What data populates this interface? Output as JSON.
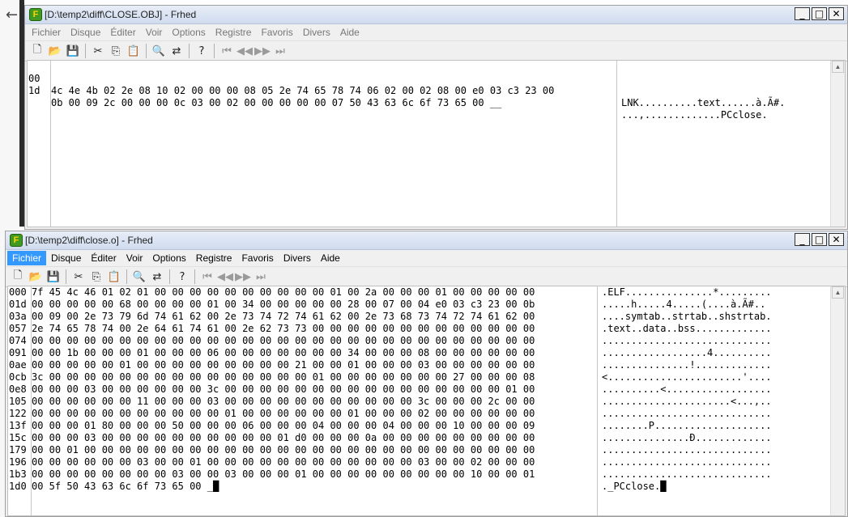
{
  "window1": {
    "title": "[D:\\temp2\\diff\\CLOSE.OBJ] - Frhed",
    "app_icon": "F",
    "menu": [
      "Fichier",
      "Disque",
      "Éditer",
      "Voir",
      "Options",
      "Registre",
      "Favoris",
      "Divers",
      "Aide"
    ],
    "rows": [
      {
        "off": "00",
        "hex": "4c 4e 4b 02 2e 08 10 02 00 00 00 08 05 2e 74 65 78 74 06 02 00 02 08 00 e0 03 c3 23 00",
        "asc": "LNK..........text......à.Ã#."
      },
      {
        "off": "1d",
        "hex": "0b 00 09 2c 00 00 00 0c 03 00 02 00 00 00 00 00 07 50 43 63 6c 6f 73 65 00 __",
        "asc": "...,.............PCclose."
      }
    ]
  },
  "window2": {
    "title": "[D:\\temp2\\diff\\close.o] - Frhed",
    "app_icon": "F",
    "menu": [
      "Fichier",
      "Disque",
      "Éditer",
      "Voir",
      "Options",
      "Registre",
      "Favoris",
      "Divers",
      "Aide"
    ],
    "active_menu": "Fichier",
    "rows": [
      {
        "off": "000",
        "hex": "7f 45 4c 46 01 02 01 00 00 00 00 00 00 00 00 00 00 01 00 2a 00 00 00 01 00 00 00 00 00",
        "asc": ".ELF...............*........."
      },
      {
        "off": "01d",
        "hex": "00 00 00 00 00 68 00 00 00 00 01 00 34 00 00 00 00 00 28 00 07 00 04 e0 03 c3 23 00 0b",
        "asc": ".....h.....4.....(....à.Ã#.."
      },
      {
        "off": "03a",
        "hex": "00 09 00 2e 73 79 6d 74 61 62 00 2e 73 74 72 74 61 62 00 2e 73 68 73 74 72 74 61 62 00",
        "asc": "....symtab..strtab..shstrtab."
      },
      {
        "off": "057",
        "hex": "2e 74 65 78 74 00 2e 64 61 74 61 00 2e 62 73 73 00 00 00 00 00 00 00 00 00 00 00 00 00",
        "asc": ".text..data..bss............."
      },
      {
        "off": "074",
        "hex": "00 00 00 00 00 00 00 00 00 00 00 00 00 00 00 00 00 00 00 00 00 00 00 00 00 00 00 00 00",
        "asc": "............................."
      },
      {
        "off": "091",
        "hex": "00 00 1b 00 00 00 01 00 00 00 06 00 00 00 00 00 00 00 34 00 00 00 08 00 00 00 00 00 00",
        "asc": "..................4.........."
      },
      {
        "off": "0ae",
        "hex": "00 00 00 00 00 01 00 00 00 00 00 00 00 00 00 21 00 00 01 00 00 00 03 00 00 00 00 00 00",
        "asc": "...............!............."
      },
      {
        "off": "0cb",
        "hex": "3c 00 00 00 00 00 00 00 00 00 00 00 00 00 00 00 01 00 00 00 00 00 00 00 27 00 00 00 08",
        "asc": "<.......................'...."
      },
      {
        "off": "0e8",
        "hex": "00 00 00 03 00 00 00 00 00 00 3c 00 00 00 00 00 00 00 00 00 00 00 00 00 00 00 00 01 00",
        "asc": "..........<.................."
      },
      {
        "off": "105",
        "hex": "00 00 00 00 00 00 11 00 00 00 03 00 00 00 00 00 00 00 00 00 00 00 3c 00 00 00 2c 00 00",
        "asc": "......................<...,.."
      },
      {
        "off": "122",
        "hex": "00 00 00 00 00 00 00 00 00 00 00 01 00 00 00 00 00 00 01 00 00 00 02 00 00 00 00 00 00",
        "asc": "............................."
      },
      {
        "off": "13f",
        "hex": "00 00 00 01 80 00 00 00 50 00 00 00 06 00 00 00 04 00 00 00 04 00 00 00 10 00 00 00 09",
        "asc": "........P...................."
      },
      {
        "off": "15c",
        "hex": "00 00 00 03 00 00 00 00 00 00 00 00 00 00 01 d0 00 00 00 0a 00 00 00 00 00 00 00 00 00",
        "asc": "...............Ð............."
      },
      {
        "off": "179",
        "hex": "00 00 01 00 00 00 00 00 00 00 00 00 00 00 00 00 00 00 00 00 00 00 00 00 00 00 00 00 00",
        "asc": "............................."
      },
      {
        "off": "196",
        "hex": "00 00 00 00 00 00 03 00 00 01 00 00 00 00 00 00 00 00 00 00 00 00 03 00 00 02 00 00 00",
        "asc": "............................."
      },
      {
        "off": "1b3",
        "hex": "00 00 00 00 00 00 00 00 03 00 00 03 00 00 00 01 00 00 00 00 00 00 00 00 00 10 00 00 01",
        "asc": "............................."
      },
      {
        "off": "1d0",
        "hex": "00 5f 50 43 63 6c 6f 73 65 00 _█",
        "asc": "._PCclose.█"
      }
    ]
  },
  "icons": {
    "back": "←",
    "new": "🗋",
    "open": "📂",
    "save": "💾",
    "cut": "✂",
    "copy": "⎘",
    "paste": "📋",
    "find": "🔍",
    "replace": "⇄",
    "help": "?",
    "first": "⏮",
    "prev": "◀◀",
    "next": "▶▶",
    "last": "⏭",
    "minimize": "_",
    "maximize": "□",
    "close": "✕",
    "scroll_up": "▲"
  }
}
